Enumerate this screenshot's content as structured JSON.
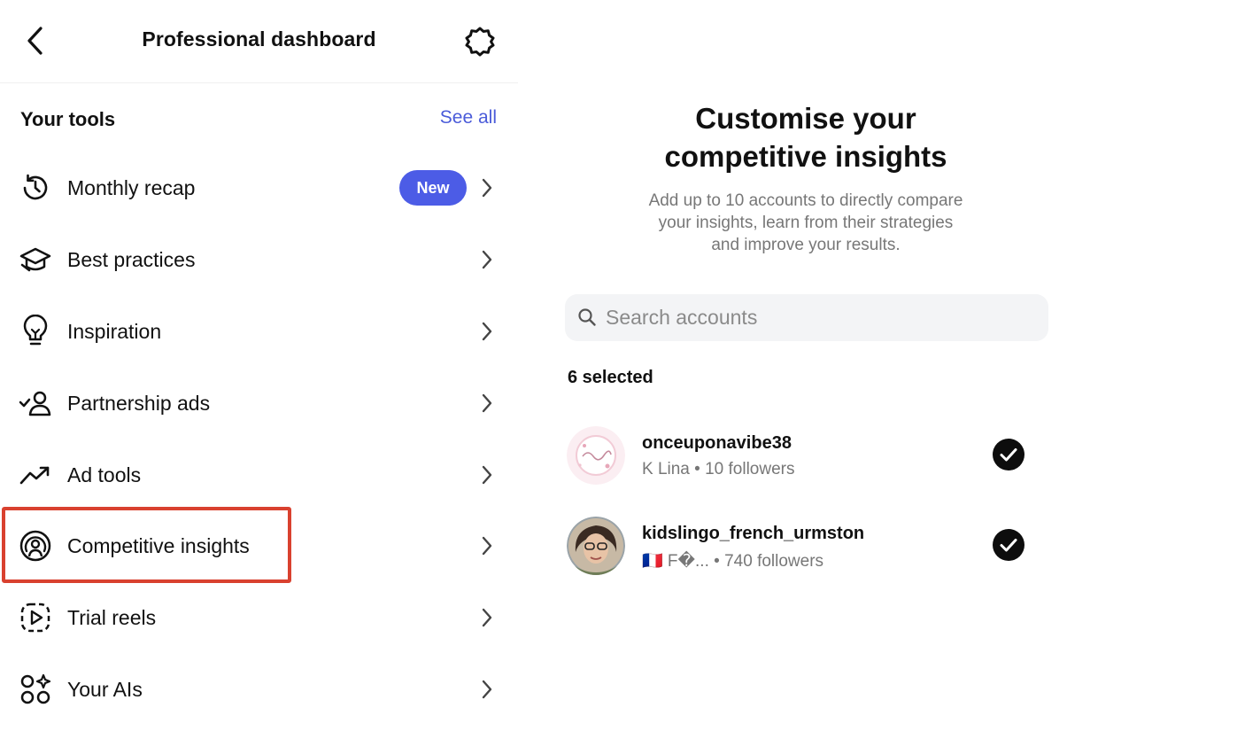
{
  "left": {
    "header": {
      "title": "Professional dashboard"
    },
    "section": {
      "title": "Your tools",
      "see_all": "See all"
    },
    "items": [
      {
        "label": "Monthly recap",
        "icon": "history-icon",
        "badge": "New"
      },
      {
        "label": "Best practices",
        "icon": "graduation-cap-icon"
      },
      {
        "label": "Inspiration",
        "icon": "lightbulb-icon"
      },
      {
        "label": "Partnership ads",
        "icon": "person-check-icon"
      },
      {
        "label": "Ad tools",
        "icon": "trend-up-icon"
      },
      {
        "label": "Competitive insights",
        "icon": "radar-person-icon",
        "highlighted": true
      },
      {
        "label": "Trial reels",
        "icon": "play-dashed-icon"
      },
      {
        "label": "Your AIs",
        "icon": "shapes-icon"
      }
    ],
    "colors": {
      "accent": "#4a5bd9",
      "badge": "#4c5ce6",
      "highlight": "#d9412f"
    }
  },
  "right": {
    "title_line1": "Customise your",
    "title_line2": "competitive insights",
    "subtitle_line1": "Add up to 10 accounts to directly compare",
    "subtitle_line2": "your insights, learn from their strategies",
    "subtitle_line3": "and improve your results.",
    "search": {
      "placeholder": "Search accounts",
      "value": ""
    },
    "selected_count": "6 selected",
    "accounts": [
      {
        "handle": "onceuponavibe38",
        "name": "K Lina",
        "separator": "•",
        "followers": "10 followers",
        "selected": true
      },
      {
        "handle": "kidslingo_french_urmston",
        "name": "🇫🇷 F�...",
        "separator": "•",
        "followers": "740 followers",
        "selected": true
      }
    ]
  }
}
